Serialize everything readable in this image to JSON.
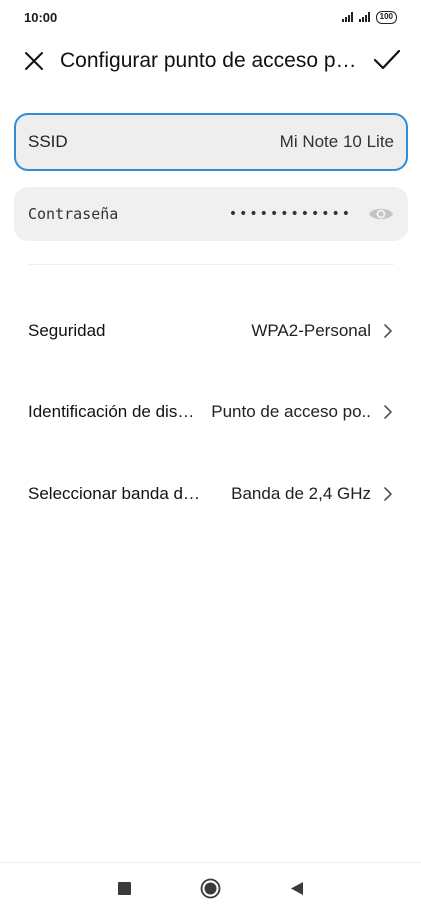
{
  "status_bar": {
    "time": "10:00",
    "battery": "100"
  },
  "header": {
    "title": "Configurar punto de acceso po…",
    "close_icon": "close-icon",
    "confirm_icon": "check-icon"
  },
  "fields": {
    "ssid": {
      "label": "SSID",
      "value": "Mi Note 10 Lite"
    },
    "password": {
      "label": "Contraseña",
      "value": "••••••••••••",
      "icon": "eye-icon"
    }
  },
  "settings": [
    {
      "label": "Seguridad",
      "value": "WPA2-Personal"
    },
    {
      "label": "Identificación de dis…",
      "value": "Punto de acceso po.."
    },
    {
      "label": "Seleccionar banda d…",
      "value": "Banda de 2,4 GHz"
    }
  ],
  "nav": {
    "recents_icon": "square-icon",
    "home_icon": "circle-icon",
    "back_icon": "triangle-back-icon"
  },
  "colors": {
    "accent": "#2e8fd8",
    "field_bg": "#f0f0f0"
  }
}
